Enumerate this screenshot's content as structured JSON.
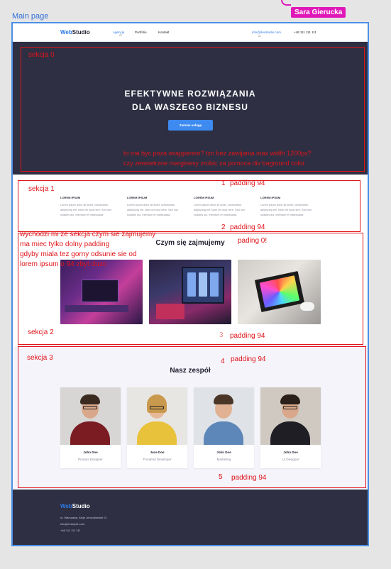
{
  "frame": {
    "label": "Main page"
  },
  "collaborator": {
    "name": "Sara Gierucka",
    "color": "#e018b8"
  },
  "header": {
    "logo_primary": "Web",
    "logo_secondary": "Studio",
    "nav": [
      "Agencja",
      "Portfolio",
      "Kontakt"
    ],
    "email": "info@devstudio.com",
    "phone": "+48 111 111 111"
  },
  "hero": {
    "title_line1": "EFEKTYWNE ROZWIĄZANIA",
    "title_line2": "DLA WASZEGO BIZNESU",
    "button": "Zamów usługę"
  },
  "features": [
    {
      "title": "LOREM IPSUM",
      "text": "Lorem ipsum dolor sit amet, consectetur adipiscing elit. Nam vel orca nere. Sed non sodales dui. Interdum et malesuada."
    },
    {
      "title": "LOREM IPSUM",
      "text": "Lorem ipsum dolor sit amet, consectetur adipiscing elit. Nam vel orca nere. Sed non sodales dui. Interdum et malesuada."
    },
    {
      "title": "LOREM IPSUM",
      "text": "Lorem ipsum dolor sit amet, consectetur adipiscing elit. Nam vel orca nere. Sed non sodales dui. Interdum et malesuada."
    },
    {
      "title": "LOREM IPSUM",
      "text": "Lorem ipsum dolor sit amet, consectetur adipiscing elit. Nam vel orca nere. Sed non sodales dui. Interdum et malesuada."
    }
  ],
  "services": {
    "title": "Czym się zajmujemy"
  },
  "team": {
    "title": "Nasz zespół",
    "members": [
      {
        "name": "John Doe",
        "role": "Product Designer"
      },
      {
        "name": "Jane Doe",
        "role": "Frontend Developer"
      },
      {
        "name": "John Doe",
        "role": "Marketing"
      },
      {
        "name": "John Doe",
        "role": "UI Designer"
      }
    ]
  },
  "footer": {
    "logo_primary": "Web",
    "logo_secondary": "Studio",
    "address": "m. Warszawa, Aleje Jerozolimskie 21",
    "email": "info@example.com",
    "phone": "+48 111 111 111"
  },
  "annotations": {
    "sekcja0": "sekcja 0",
    "wrapper_note_1": "to ma byc poza wrapperem? tzn  bez zawijania max width 1200px?",
    "wrapper_note_2": "czy zewnetrzne marginesy zrobic za pomoca div baground color",
    "sekcja1": "sekcja 1",
    "num1": "1",
    "pad1": "padding 94",
    "num2": "2",
    "pad2": "padding 94",
    "note_a": "wychodzi mi ze sekcja czym sie zajmujemy",
    "note_b": "ma miec tylko dolny padding",
    "note_c": "gdyby miala tez gorny odsunie sie od",
    "note_d": "lorem ipsum o 94 zbyt duzo",
    "pad0": "pading 0!",
    "sekcja2": "sekcja 2",
    "num3": "3",
    "pad3": "padding 94",
    "sekcja3": "sekcja 3",
    "num4": "4",
    "pad4": "padding 94",
    "num5": "5",
    "pad5": "padding 94"
  }
}
